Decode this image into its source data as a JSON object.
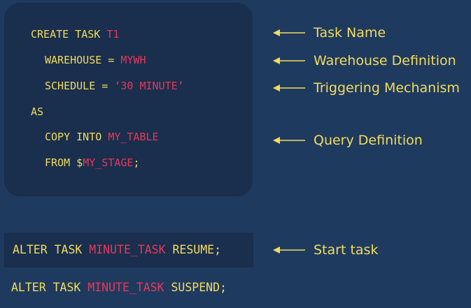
{
  "task_block": {
    "line1_kw": "CREATE TASK",
    "line1_id": "T1",
    "line2_kw": "WAREHOUSE =",
    "line2_id": "MYWH",
    "line3_kw": "SCHEDULE =",
    "line3_id": "‘30 MINUTE’",
    "line4_kw": "AS",
    "line5_kw": "COPY INTO",
    "line5_id": "MY_TABLE",
    "line6_kw": "FROM $",
    "line6_id": "MY_STAGE",
    "line6_end": ";"
  },
  "resume_stmt": {
    "kw1": "ALTER TASK",
    "id": "MINUTE_TASK",
    "kw2": "RESUME;"
  },
  "suspend_stmt": {
    "kw1": "ALTER TASK",
    "id": "MINUTE_TASK",
    "kw2": "SUSPEND;"
  },
  "annotations": [
    "Task Name",
    "Warehouse Definition",
    "Triggering Mechanism",
    "Query Definition",
    "Start task"
  ],
  "colors": {
    "background": "#1f3a5f",
    "panel": "#1a2e4d",
    "keyword": "#f2dc5d",
    "identifier": "#e8385b"
  }
}
